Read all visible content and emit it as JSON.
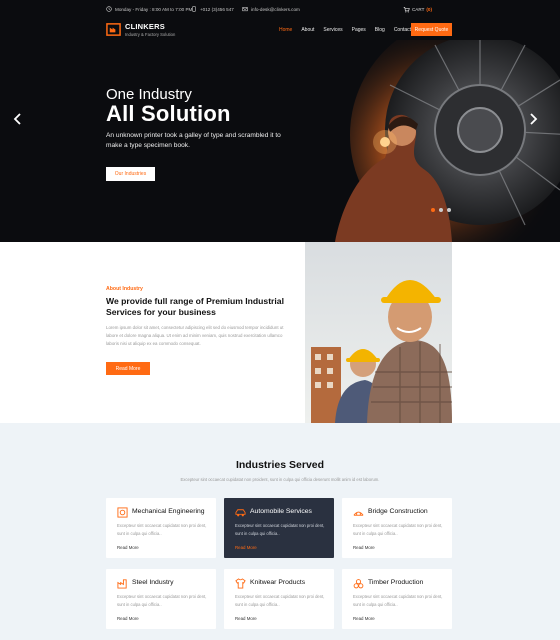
{
  "topbar": {
    "hours": "Monday - Friday : 8:00 AM to 7:00 PM",
    "phone": "+012 (3)456 547",
    "email": "info-desk@clinkers.com",
    "cart_label": "CART",
    "cart_count": "(0)"
  },
  "brand": {
    "name": "CLINKERS",
    "tagline": "Industry & Factory Solution"
  },
  "nav": {
    "items": [
      "Home",
      "About",
      "Services",
      "Pages",
      "Blog",
      "Contact"
    ],
    "active": "Home",
    "quote_label": "Request Quote"
  },
  "hero": {
    "subtitle": "One Industry",
    "title": "All Solution",
    "description": "An unknown printer took a galley of type and scrambled it to make a type specimen book.",
    "button_label": "Our Industries",
    "prev_icon": "chevron-left-icon",
    "next_icon": "chevron-right-icon",
    "slides": 3,
    "active_slide": 1
  },
  "about": {
    "eyebrow": "About Industry",
    "title": "We provide full range of Premium Industrial Services for your business",
    "description": "Lorem ipsum dolor sit amet, consectetur adipiscing elit sed do eiusmod tempor incididunt ut labore et dolore magna aliqua. Ut enim ad minim veniam, quis nostrud exercitation ullamco laboris nisi ut aliquip ex ea commodo consequat.",
    "button_label": "Read More"
  },
  "industries": {
    "title": "Industries Served",
    "subtitle": "Excepteur sint occaecat cupidatat non proident, sunt in culpa qui officia deserunt mollit anim id est laborum.",
    "cards": [
      {
        "title": "Mechanical Engineering",
        "text": "Excepteur sint occaecat cupidatat non proi dent, sunt in culpa qui officia..",
        "more": "Read More",
        "icon": "gear-icon"
      },
      {
        "title": "Automobile Services",
        "text": "Excepteur sint occaecat cupidatat non proi dent, sunt in culpa qui officia..",
        "more": "Read More",
        "icon": "car-icon"
      },
      {
        "title": "Bridge Construction",
        "text": "Excepteur sint occaecat cupidatat non proi dent, sunt in culpa qui officia..",
        "more": "Read More",
        "icon": "bridge-icon"
      },
      {
        "title": "Steel Industry",
        "text": "Excepteur sint occaecat cupidatat non proi dent, sunt in culpa qui officia..",
        "more": "Read More",
        "icon": "factory-icon"
      },
      {
        "title": "Knitwear Products",
        "text": "Excepteur sint occaecat cupidatat non proi dent, sunt in culpa qui officia..",
        "more": "Read More",
        "icon": "shirt-icon"
      },
      {
        "title": "Timber Production",
        "text": "Excepteur sint occaecat cupidatat non proi dent, sunt in culpa qui officia..",
        "more": "Read More",
        "icon": "timber-icon"
      }
    ]
  },
  "colors": {
    "accent": "#ff6a13",
    "hero_bg": "#0b0c0f",
    "section_bg": "#eef3f7",
    "dark_card": "#2a3140"
  }
}
